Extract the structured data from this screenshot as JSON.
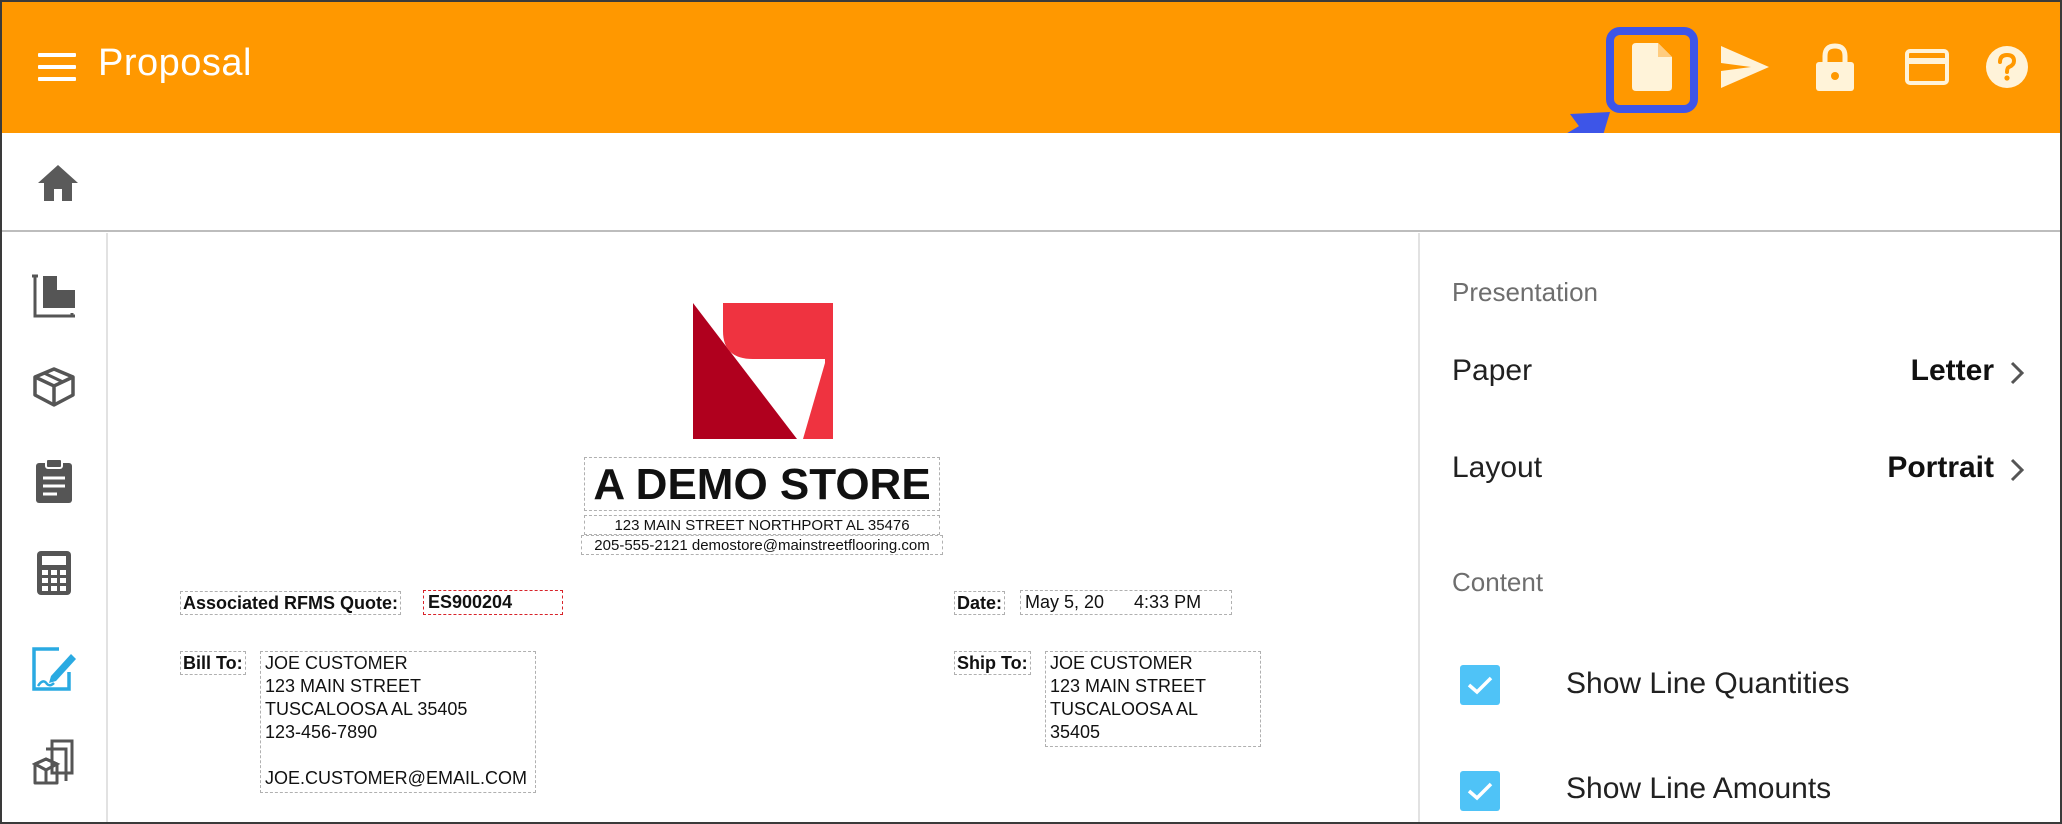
{
  "appbar": {
    "title": "Proposal",
    "actions": [
      "document-icon",
      "send-icon",
      "lock-icon",
      "credit-card-icon",
      "help-icon"
    ],
    "highlighted_action": "document-icon"
  },
  "breadcrumb": {
    "home": "home-icon"
  },
  "rail": {
    "items": [
      "floor-measure-icon",
      "package-icon",
      "clipboard-icon",
      "calculator-icon",
      "edit-document-icon",
      "boxes-icon"
    ],
    "active": "edit-document-icon"
  },
  "document": {
    "store_name": "A DEMO STORE",
    "address_line": "123 MAIN STREET NORTHPORT AL 35476",
    "contact_line": "205-555-2121  demostore@mainstreetflooring.com",
    "quote_label": "Associated RFMS Quote:",
    "quote_value": "ES900204",
    "date_label": "Date:",
    "date_value": "May 5, 20      4:33 PM",
    "bill_to_label": "Bill To:",
    "bill_to": {
      "name": "JOE CUSTOMER",
      "street": "123 MAIN STREET",
      "city": "TUSCALOOSA AL 35405",
      "phone": "123-456-7890",
      "email": "JOE.CUSTOMER@EMAIL.COM"
    },
    "ship_to_label": "Ship To:",
    "ship_to": {
      "name": "JOE CUSTOMER",
      "street": "123 MAIN STREET",
      "city": "TUSCALOOSA AL",
      "zip": "35405"
    }
  },
  "panel": {
    "presentation_heading": "Presentation",
    "paper_label": "Paper",
    "paper_value": "Letter",
    "layout_label": "Layout",
    "layout_value": "Portrait",
    "content_heading": "Content",
    "options": [
      {
        "label": "Show Line Quantities",
        "checked": true
      },
      {
        "label": "Show Line Amounts",
        "checked": true
      }
    ]
  },
  "colors": {
    "appbar": "#ff9800",
    "highlight": "#3d55e8",
    "accent": "#2aaae2",
    "checkbox": "#4fc3f7",
    "logo_dark": "#b0001e",
    "logo_light": "#ef3340"
  }
}
